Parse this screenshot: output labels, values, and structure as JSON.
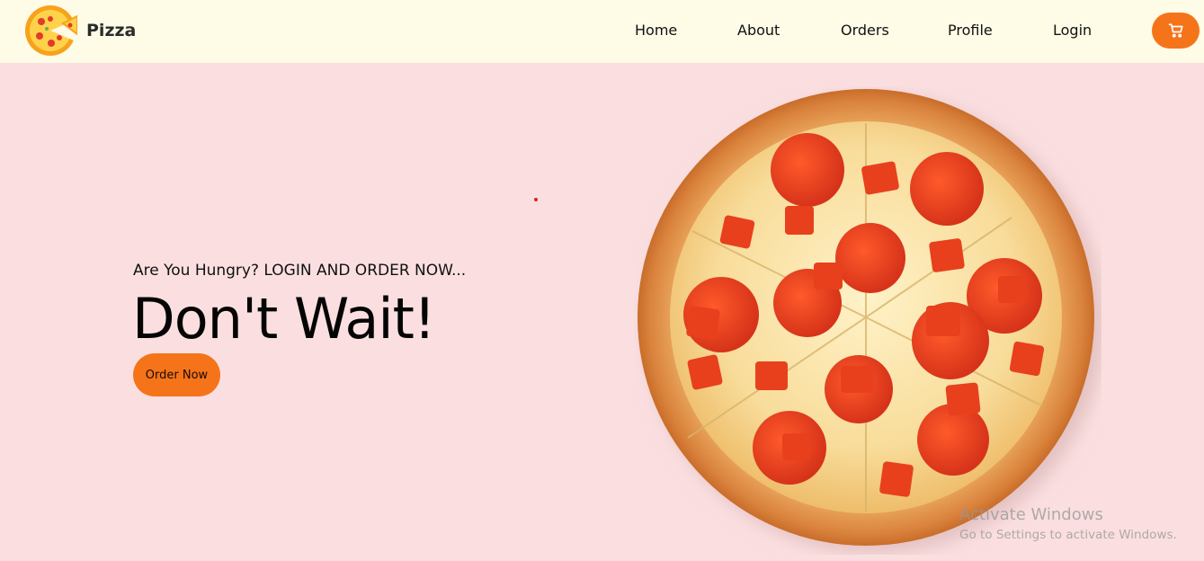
{
  "brand": {
    "name": "Pizza",
    "logo_icon": "pizza-slice-logo-icon"
  },
  "nav": {
    "items": [
      {
        "label": "Home"
      },
      {
        "label": "About"
      },
      {
        "label": "Orders"
      },
      {
        "label": "Profile"
      },
      {
        "label": "Login"
      }
    ],
    "cart_icon": "cart-icon"
  },
  "hero": {
    "tagline": "Are You Hungry? LOGIN AND ORDER NOW...",
    "title": "Don't Wait!",
    "cta_label": "Order Now",
    "image_icon": "pepperoni-pizza-image"
  },
  "watermark": {
    "title": "Activate Windows",
    "subtitle": "Go to Settings to activate Windows."
  },
  "colors": {
    "navbar_bg": "#fefbe6",
    "page_bg": "#fbdfe0",
    "accent": "#f5741a"
  }
}
